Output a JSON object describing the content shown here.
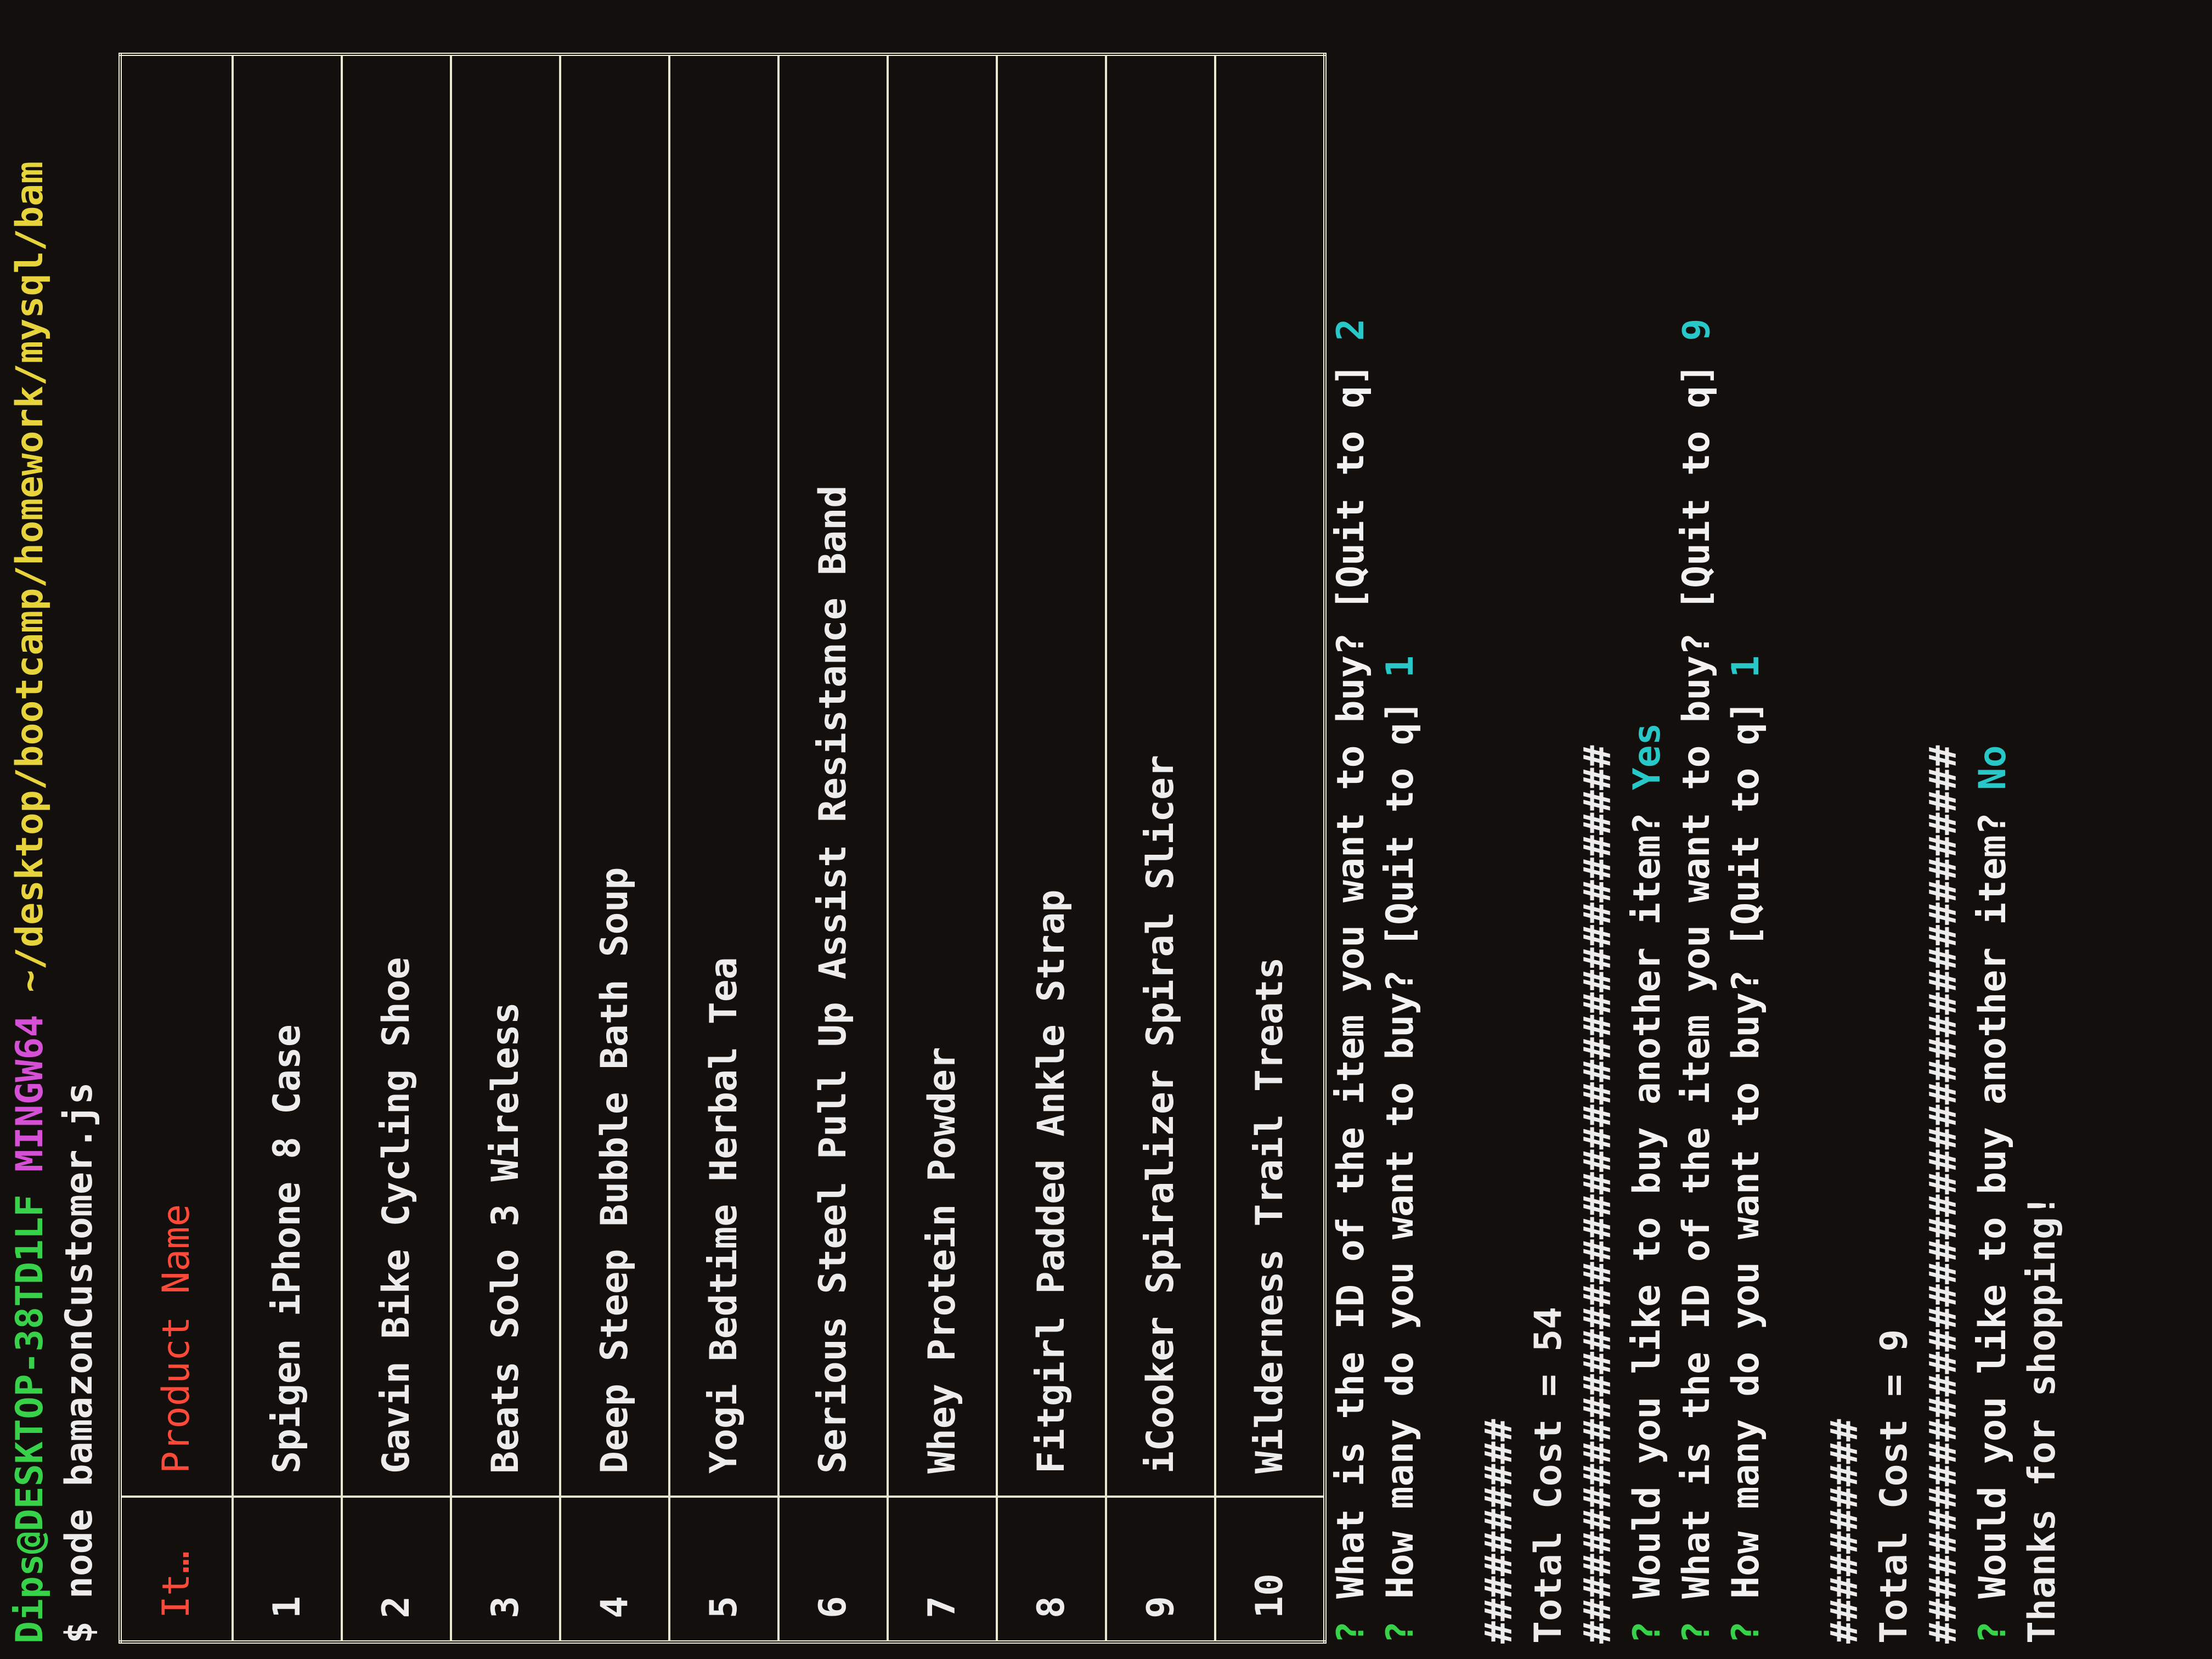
{
  "prompt": {
    "user_host": "Dips@DESKTOP-38TD1LF",
    "shell": "MINGW64",
    "path": "~/desktop/bootcamp/homework/mysql/bam",
    "symbol": "$",
    "command": "node bamazonCustomer.js"
  },
  "table": {
    "headers": [
      "It…",
      "Product Name"
    ],
    "rows": [
      {
        "id": "1",
        "name": "Spigen iPhone 8 Case"
      },
      {
        "id": "2",
        "name": "Gavin Bike Cycling Shoe"
      },
      {
        "id": "3",
        "name": "Beats Solo 3 Wireless"
      },
      {
        "id": "4",
        "name": "Deep Steep Bubble Bath Soup"
      },
      {
        "id": "5",
        "name": "Yogi Bedtime Herbal Tea"
      },
      {
        "id": "6",
        "name": "Serious Steel Pull Up Assist Resistance Band"
      },
      {
        "id": "7",
        "name": "Whey Protein Powder"
      },
      {
        "id": "8",
        "name": "Fitgirl Padded Ankle Strap"
      },
      {
        "id": "9",
        "name": "iCooker Spiralizer Spiral Slicer"
      },
      {
        "id": "10",
        "name": "Wilderness Trail Treats"
      }
    ]
  },
  "session": {
    "q_mark": "?",
    "q1": "What is the ID of the item you want to buy? [Quit to q]",
    "a1": "2",
    "q2": "How many do you want to buy? [Quit to q]",
    "a2": "1",
    "hash_short": "##########",
    "total1": "Total Cost = 54",
    "hash_long": "########################################",
    "q3": "Would you like to buy another item?",
    "a3": "Yes",
    "q4": "What is the ID of the item you want to buy? [Quit to q]",
    "a4": "9",
    "q5": "How many do you want to buy? [Quit to q]",
    "a5": "1",
    "total2": "Total Cost = 9",
    "q6": "Would you like to buy another item?",
    "a6": "No",
    "thanks": "Thanks for shopping!"
  }
}
